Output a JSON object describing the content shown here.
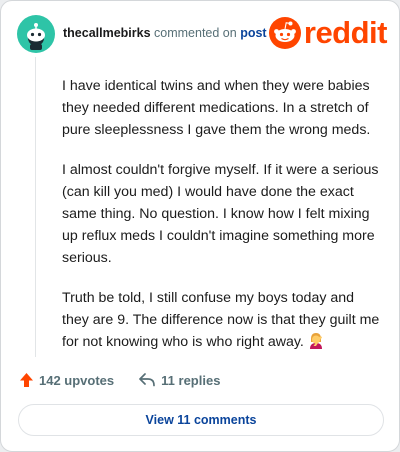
{
  "comment": {
    "username": "thecallmebirks",
    "action_text": "commented on",
    "post_link": "post",
    "paragraphs": [
      "I have identical twins and when they were babies they needed different medications. In a stretch of pure sleeplessness I gave them the wrong meds.",
      "I almost couldn't forgive myself. If it were a serious (can kill you med) I would have done the exact same thing. No question. I know how I felt mixing up reflux meds I couldn't imagine something more serious.",
      "Truth be told, I still confuse my boys today and they are 9. The difference now is that they guilt me for not knowing who is who right away."
    ],
    "emoji": "person-facepalming",
    "upvotes": "142 upvotes",
    "replies": "11 replies",
    "view_comments": "View 11 comments"
  },
  "brand": {
    "name": "reddit",
    "color": "#ff4500"
  },
  "colors": {
    "avatar": "#2ec4a7",
    "upvote": "#ff4500",
    "link": "#0a449b"
  }
}
